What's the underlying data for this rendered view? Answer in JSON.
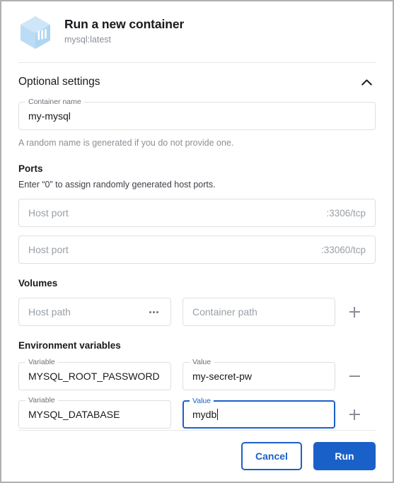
{
  "header": {
    "icon": "container-box-icon",
    "title": "Run a new container",
    "subtitle": "mysql:latest"
  },
  "optional_settings": {
    "title": "Optional settings",
    "collapse_icon": "chevron-up-icon",
    "container_name": {
      "label": "Container name",
      "value": "my-mysql",
      "helper": "A random name is generated if you do not provide one."
    }
  },
  "ports": {
    "title": "Ports",
    "helper": "Enter “0” to assign randomly generated host ports.",
    "rows": [
      {
        "placeholder": "Host port",
        "value": "",
        "suffix": ":3306/tcp"
      },
      {
        "placeholder": "Host port",
        "value": "",
        "suffix": ":33060/tcp"
      }
    ]
  },
  "volumes": {
    "title": "Volumes",
    "host_path_placeholder": "Host path",
    "browse_icon": "ellipsis-icon",
    "container_path_placeholder": "Container path",
    "add_icon": "plus-icon"
  },
  "environment_variables": {
    "title": "Environment variables",
    "rows": [
      {
        "variable_label": "Variable",
        "variable_value": "MYSQL_ROOT_PASSWORD",
        "value_label": "Value",
        "value_value": "my-secret-pw",
        "action_icon": "minus-icon",
        "focused": false
      },
      {
        "variable_label": "Variable",
        "variable_value": "MYSQL_DATABASE",
        "value_label": "Value",
        "value_value": "mydb",
        "action_icon": "plus-icon",
        "focused": true
      }
    ]
  },
  "footer": {
    "cancel_label": "Cancel",
    "run_label": "Run"
  },
  "colors": {
    "accent_blue": "#1a60c9",
    "icon_blue": "#bcdcf5",
    "text_primary": "#17191c",
    "text_muted": "#8a8f97",
    "border": "#dcdfe3"
  }
}
